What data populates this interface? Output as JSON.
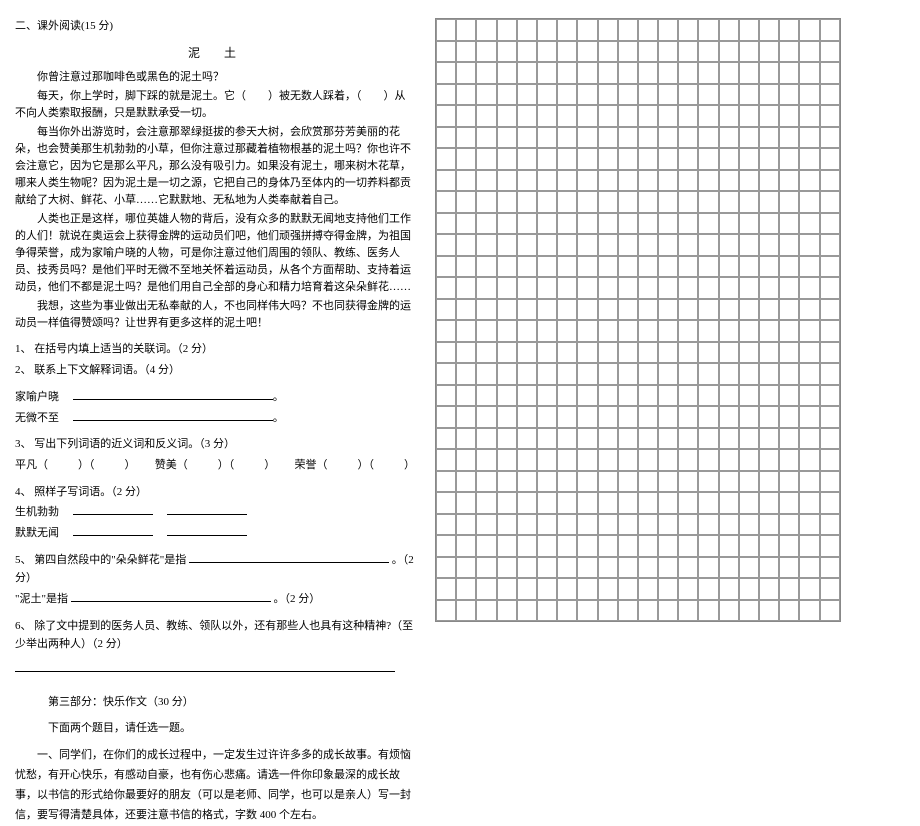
{
  "section": {
    "title": "二、课外阅读(15 分)",
    "passage_title": "泥　土",
    "p1": "你曾注意过那咖啡色或黑色的泥土吗？",
    "p2": "每天，你上学时，脚下踩的就是泥土。它（　　）被无数人踩着，（　　）从不向人类索取报酬，只是默默承受一切。",
    "p3": "每当你外出游览时，会注意那翠绿挺拔的参天大树，会欣赏那芬芳美丽的花朵，也会赞美那生机勃勃的小草，但你注意过那藏着植物根基的泥土吗？你也许不会注意它，因为它是那么平凡，那么没有吸引力。如果没有泥土，哪来树木花草，哪来人类生物呢？因为泥土是一切之源，它把自己的身体乃至体内的一切养料都贡献给了大树、鲜花、小草……它默默地、无私地为人类奉献着自己。",
    "p4": "人类也正是这样，哪位英雄人物的背后，没有众多的默默无闻地支持他们工作的人们！就说在奥运会上获得金牌的运动员们吧，他们顽强拼搏夺得金牌，为祖国争得荣誉，成为家喻户晓的人物，可是你注意过他们周围的领队、教练、医务人员、技秀员吗？是他们平时无微不至地关怀着运动员，从各个方面帮助、支持着运动员，他们不都是泥土吗？是他们用自己全部的身心和精力培育着这朵朵鲜花……",
    "p5": "我想，这些为事业做出无私奉献的人，不也同样伟大吗？不也同获得金牌的运动员一样值得赞颂吗？让世界有更多这样的泥土吧！",
    "q1": "1、 在括号内填上适当的关联词。（2 分）",
    "q2": "2、 联系上下文解释词语。（4 分）",
    "q2_term1": "家喻户晓",
    "q2_term2": "无微不至",
    "q3": "3、 写出下列词语的近义词和反义词。（3 分）",
    "q3_w1": "平凡（",
    "q3_w2": "赞美（",
    "q3_w3": "荣誉（",
    "q4": "4、 照样子写词语。（2 分）",
    "q4_ex1": "生机勃勃",
    "q4_ex2": "默默无闻",
    "q5_a": "5、 第四自然段中的\"朵朵鲜花\"是指",
    "q5_b": "\"泥土\"是指",
    "q5_pts": "。（2 分）",
    "q6": "6、 除了文中提到的医务人员、教练、领队以外，还有那些人也具有这种精神?（至少举出两种人）（2 分）"
  },
  "part3": {
    "title": "第三部分：快乐作文（30 分）",
    "sub": "下面两个题目，请任选一题。",
    "body": "一、同学们，在你们的成长过程中，一定发生过许许多多的成长故事。有烦恼忧愁，有开心快乐，有感动自豪，也有伤心悲痛。请选一件你印象最深的成长故事，以书信的形式给你最要好的朋友（可以是老师、同学，也可以是亲人）写一封信，要写得清楚具体，还要注意书信的格式，字数 400 个左右。"
  },
  "grid": {
    "cols": 20,
    "rows": 28
  }
}
